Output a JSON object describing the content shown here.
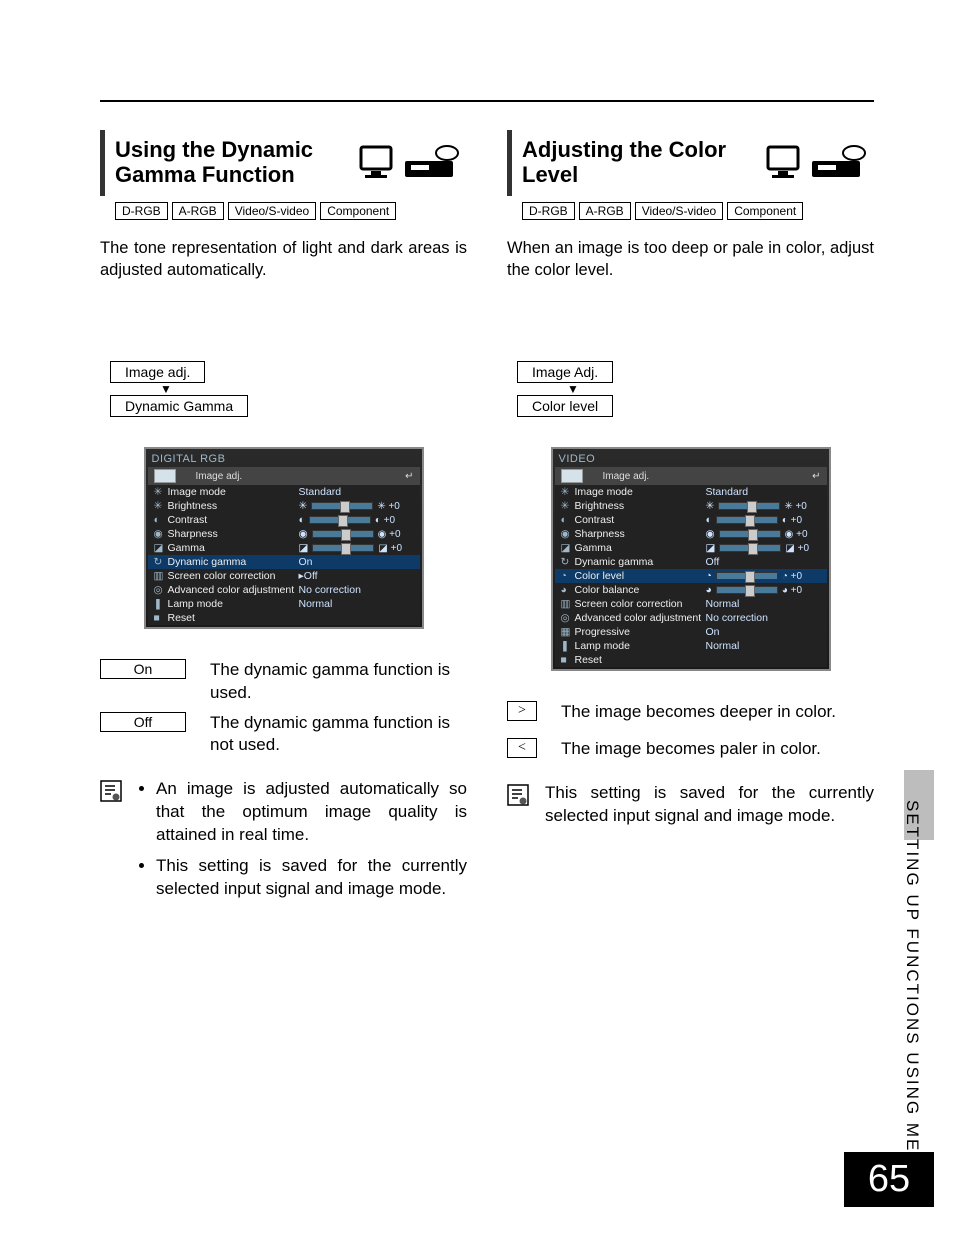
{
  "sideLabel": "SETTING UP FUNCTIONS USING MENUS",
  "pageNumber": "65",
  "left": {
    "heading": "Using the Dynamic Gamma Function",
    "badges": [
      "D-RGB",
      "A-RGB",
      "Video/S-video",
      "Component"
    ],
    "intro": "The tone representation of light and dark areas is adjusted automatically.",
    "path1": "Image adj.",
    "path2": "Dynamic Gamma",
    "osdTitle": "DIGITAL RGB",
    "osdTab": "Image adj.",
    "osdRows": [
      {
        "icon": "✳",
        "label": "Image mode",
        "val": "Standard",
        "sel": false
      },
      {
        "icon": "✳",
        "label": "Brightness",
        "val": "slider:✳ +0",
        "sel": false
      },
      {
        "icon": "◐",
        "label": "Contrast",
        "val": "slider:◐ +0",
        "sel": false
      },
      {
        "icon": "◉",
        "label": "Sharpness",
        "val": "slider:◉ +0",
        "sel": false
      },
      {
        "icon": "◪",
        "label": "Gamma",
        "val": "slider:◪ +0",
        "sel": false
      },
      {
        "icon": "↻",
        "label": "Dynamic gamma",
        "val": "On",
        "sel": true
      },
      {
        "icon": "▥",
        "label": "Screen color correction",
        "val": "▸Off",
        "sel": false
      },
      {
        "icon": "◎",
        "label": "Advanced color adjustment",
        "val": "No correction",
        "sel": false
      },
      {
        "icon": "❚",
        "label": "Lamp mode",
        "val": "Normal",
        "sel": false
      },
      {
        "icon": "■",
        "label": "Reset",
        "val": "",
        "sel": false
      }
    ],
    "opts": [
      {
        "key": "On",
        "desc": "The dynamic gamma function is used."
      },
      {
        "key": "Off",
        "desc": "The dynamic gamma function is not used."
      }
    ],
    "notes": [
      "An image is adjusted automatically so that the optimum image quality is attained in real time.",
      "This setting is saved for the currently selected input signal and image mode."
    ]
  },
  "right": {
    "heading": "Adjusting the Color Level",
    "badges": [
      "D-RGB",
      "A-RGB",
      "Video/S-video",
      "Component"
    ],
    "intro": "When an image is too deep or pale in color, adjust the color level.",
    "path1": "Image Adj.",
    "path2": "Color level",
    "osdTitle": "VIDEO",
    "osdTab": "Image adj.",
    "osdRows": [
      {
        "icon": "✳",
        "label": "Image mode",
        "val": "Standard",
        "sel": false
      },
      {
        "icon": "✳",
        "label": "Brightness",
        "val": "slider:✳ +0",
        "sel": false
      },
      {
        "icon": "◐",
        "label": "Contrast",
        "val": "slider:◐ +0",
        "sel": false
      },
      {
        "icon": "◉",
        "label": "Sharpness",
        "val": "slider:◉ +0",
        "sel": false
      },
      {
        "icon": "◪",
        "label": "Gamma",
        "val": "slider:◪ +0",
        "sel": false
      },
      {
        "icon": "↻",
        "label": "Dynamic gamma",
        "val": "Off",
        "sel": false
      },
      {
        "icon": "◔",
        "label": "Color level",
        "val": "slider:◔ +0",
        "sel": true
      },
      {
        "icon": "◕",
        "label": "Color balance",
        "val": "slider:◕ +0",
        "sel": false
      },
      {
        "icon": "▥",
        "label": "Screen color correction",
        "val": "Normal",
        "sel": false
      },
      {
        "icon": "◎",
        "label": "Advanced color adjustment",
        "val": "No correction",
        "sel": false
      },
      {
        "icon": "▦",
        "label": "Progressive",
        "val": "On",
        "sel": false
      },
      {
        "icon": "❚",
        "label": "Lamp mode",
        "val": "Normal",
        "sel": false
      },
      {
        "icon": "■",
        "label": "Reset",
        "val": "",
        "sel": false
      }
    ],
    "opts": [
      {
        "sym": ">",
        "desc": "The image becomes deeper in color."
      },
      {
        "sym": "<",
        "desc": "The image becomes paler in color."
      }
    ],
    "notes": [
      "This setting is saved for the currently selected input signal and image mode."
    ]
  }
}
